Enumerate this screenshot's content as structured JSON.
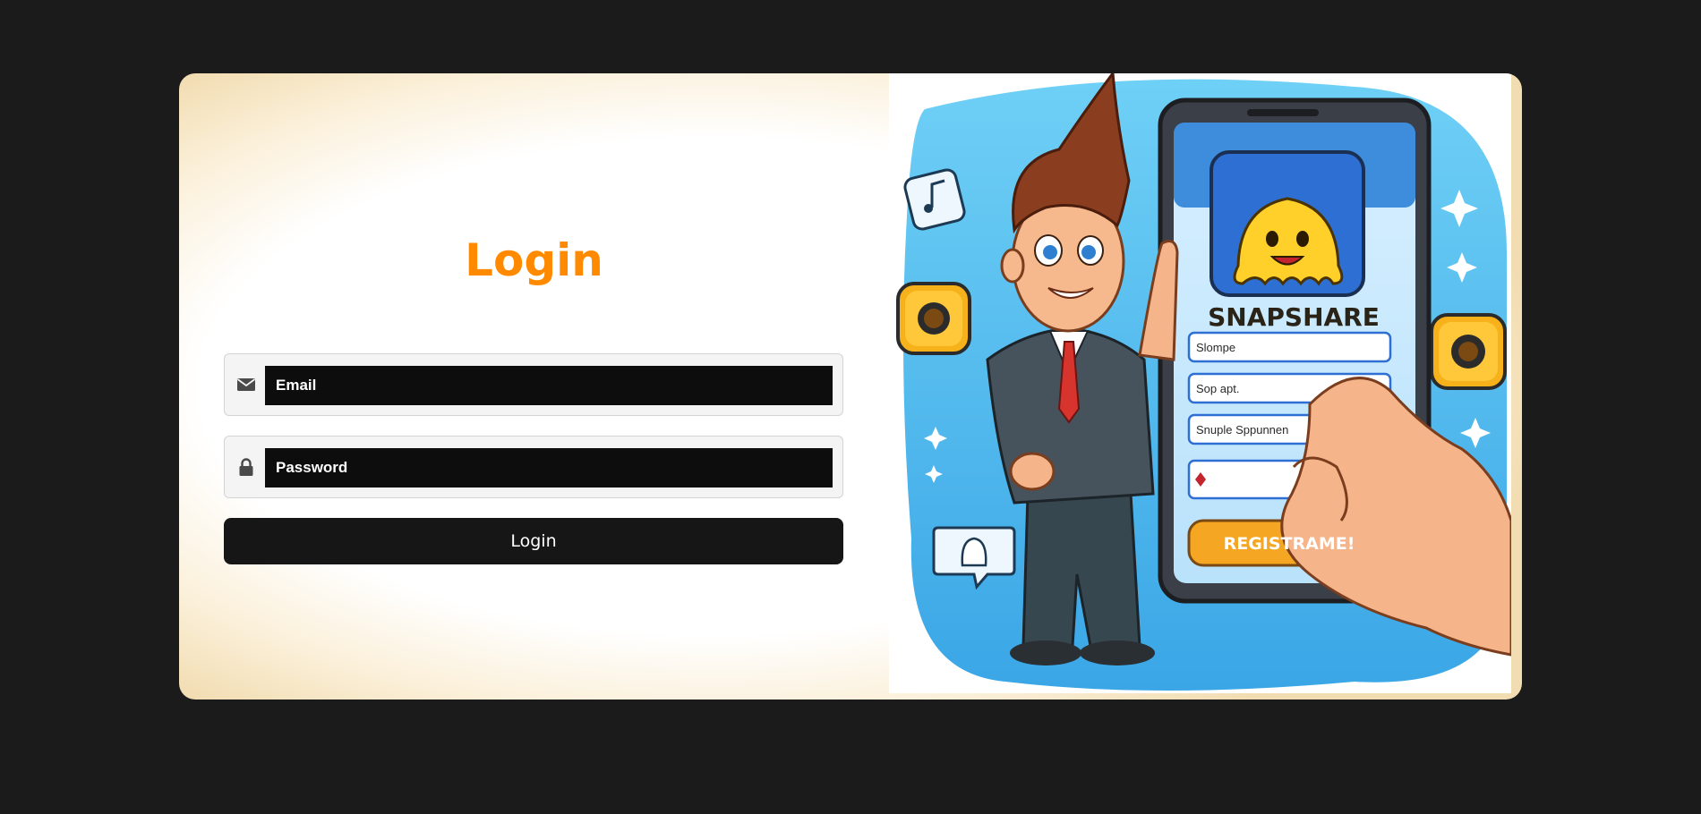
{
  "login": {
    "title": "Login",
    "email_placeholder": "Email",
    "password_placeholder": "Password",
    "submit_label": "Login"
  },
  "illustration": {
    "app_name": "SNAPSHARE",
    "field_1": "Slompe",
    "field_2": "Sop apt.",
    "field_3": "Snuple Sppunnen",
    "register_button": "REGISTRAME!"
  },
  "icons": {
    "email": "envelope-icon",
    "password": "lock-icon"
  },
  "colors": {
    "background": "#1b1b1b",
    "title": "#ff8a00",
    "input_fill": "#0d0d0d",
    "button_fill": "#161616",
    "illustration_sky": "#5ec3ef",
    "register_button": "#f5a623"
  }
}
